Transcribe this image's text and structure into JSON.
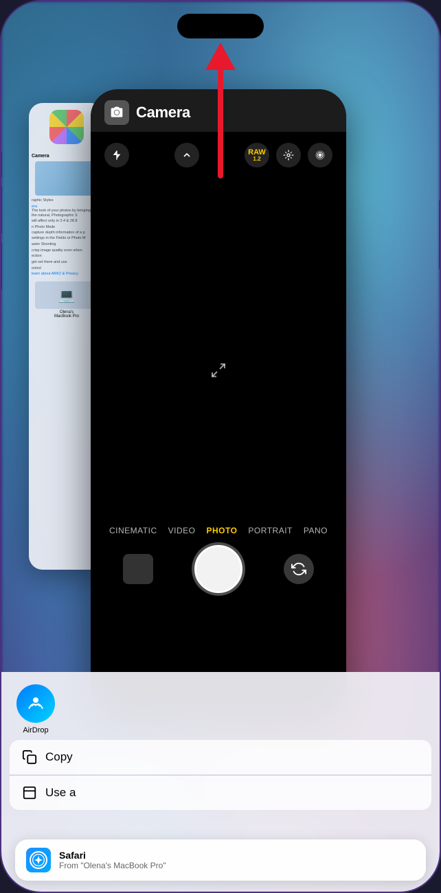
{
  "phone": {
    "background_color": "#2d1b69"
  },
  "camera_app": {
    "title": "Camera",
    "icon": "📷",
    "modes": [
      "CINEMATIC",
      "VIDEO",
      "PHOTO",
      "PORTRAIT",
      "PANO"
    ],
    "active_mode": "PHOTO",
    "controls": {
      "flash": "✕",
      "chevron": "^",
      "raw_label": "RAW",
      "raw_sub": "1.2",
      "live": "〇",
      "stabilize": "◎"
    }
  },
  "share_sheet": {
    "apps": [
      {
        "name": "AirDrop",
        "icon": "airdrop"
      }
    ],
    "actions": [
      {
        "label": "Copy"
      },
      {
        "label": "Use as"
      }
    ]
  },
  "handoff_bar": {
    "title": "Safari",
    "subtitle": "From \"Olena's MacBook Pro\""
  },
  "photos_content": {
    "title": "Camera",
    "sections": [
      "raphic Styles",
      "era",
      "n Photo Mode",
      "aster Shooting",
      "ection",
      "ontrol"
    ],
    "laptop_label": "Olena's\nMacBook Pro"
  },
  "red_arrow": {
    "direction": "up",
    "color": "#e8192c"
  },
  "dock": {
    "icons": [
      "green",
      "blue",
      "gray",
      "dark"
    ]
  }
}
